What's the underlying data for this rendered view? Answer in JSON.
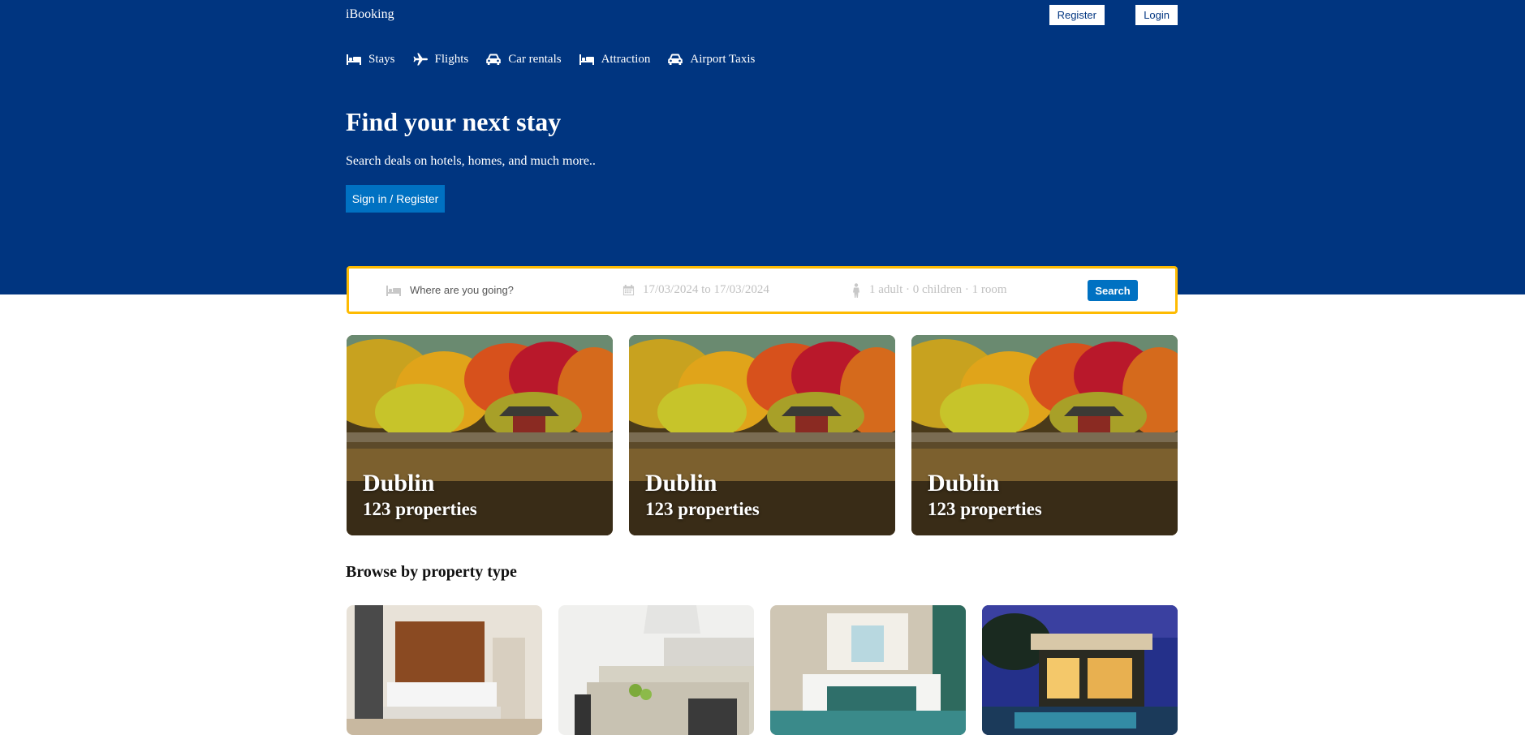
{
  "header": {
    "logo": "iBooking",
    "register_label": "Register",
    "login_label": "Login",
    "nav": [
      {
        "label": "Stays",
        "icon": "bed-icon"
      },
      {
        "label": "Flights",
        "icon": "plane-icon"
      },
      {
        "label": "Car rentals",
        "icon": "car-icon"
      },
      {
        "label": "Attraction",
        "icon": "bed-icon"
      },
      {
        "label": "Airport Taxis",
        "icon": "taxi-icon"
      }
    ],
    "title": "Find your next stay",
    "subtitle": "Search deals on hotels, homes, and much more..",
    "cta_label": "Sign in / Register"
  },
  "search": {
    "destination_placeholder": "Where are you going?",
    "dates": "17/03/2024 to 17/03/2024",
    "guests": "1 adult · 0 children · 1 room",
    "button_label": "Search"
  },
  "featured": [
    {
      "city": "Dublin",
      "properties": "123 properties"
    },
    {
      "city": "Dublin",
      "properties": "123 properties"
    },
    {
      "city": "Dublin",
      "properties": "123 properties"
    }
  ],
  "property_types": {
    "title": "Browse by property type"
  },
  "colors": {
    "brand": "#003580",
    "accent": "#0071c2",
    "search_border": "#febb02"
  }
}
